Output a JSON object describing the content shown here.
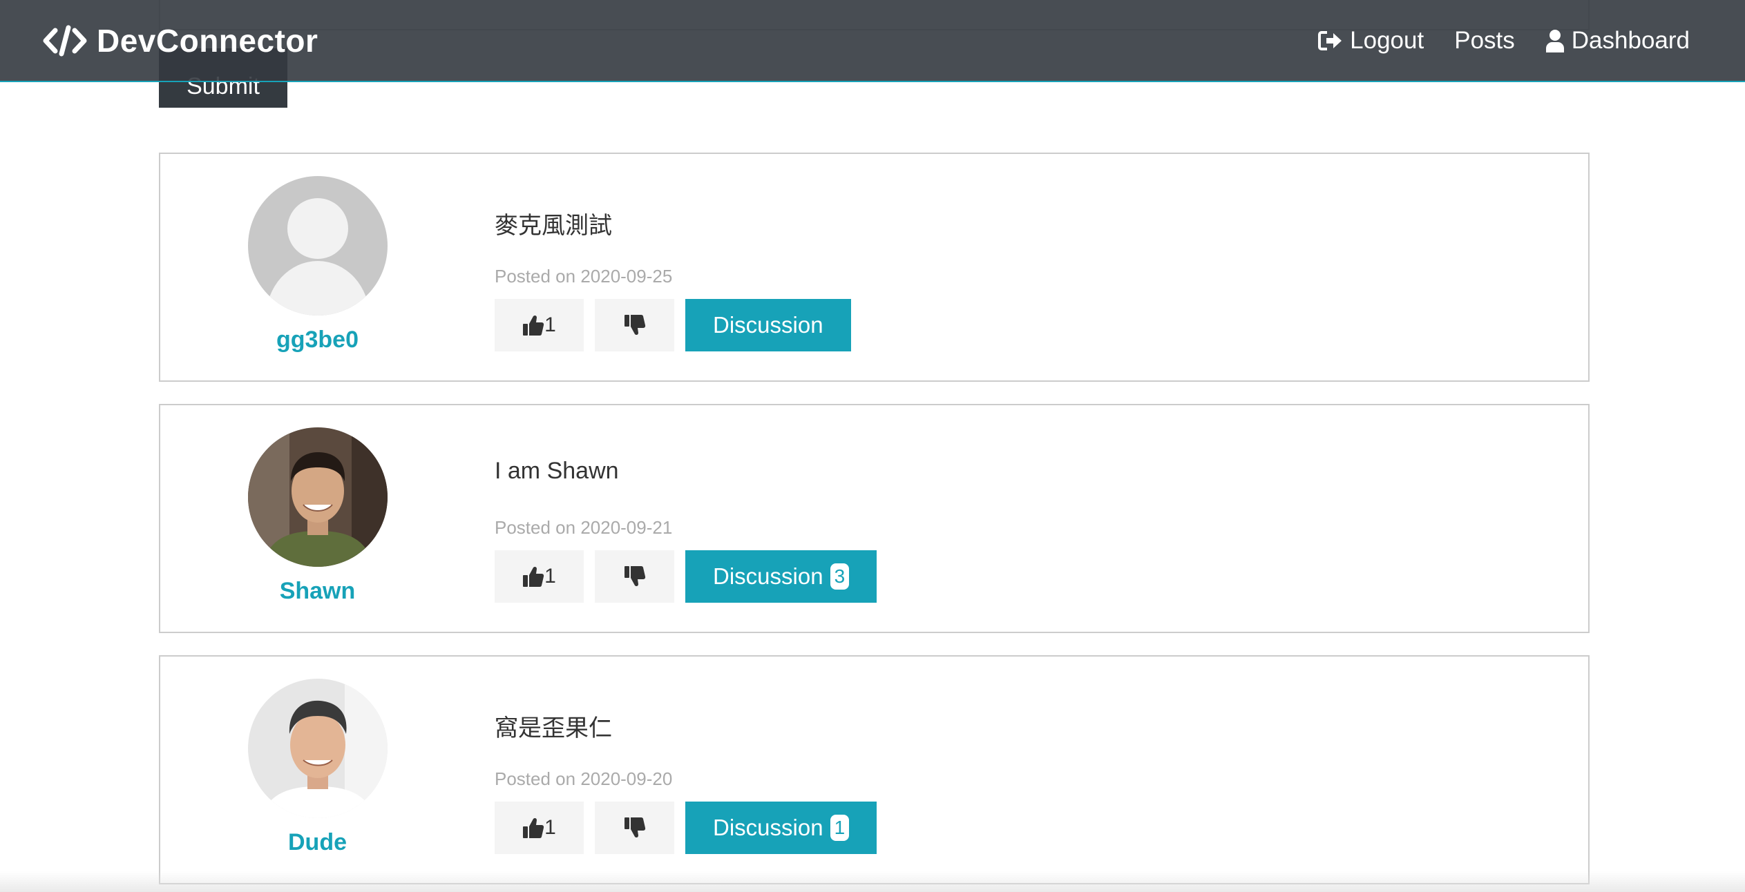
{
  "form": {
    "submit_label": "Submit"
  },
  "navbar": {
    "brand": "DevConnector",
    "links": [
      {
        "label": "Logout",
        "icon": "logout-icon"
      },
      {
        "label": "Posts"
      },
      {
        "label": "Dashboard",
        "icon": "user-icon"
      }
    ]
  },
  "posts": [
    {
      "author": "gg3be0",
      "avatar": "default-avatar",
      "text": "麥克風測試",
      "date": "Posted on 2020-09-25",
      "likes": "1",
      "discussion_label": "Discussion",
      "comments": ""
    },
    {
      "author": "Shawn",
      "avatar": "photo-avatar",
      "text": "I am Shawn",
      "date": "Posted on 2020-09-21",
      "likes": "1",
      "discussion_label": "Discussion",
      "comments": "3"
    },
    {
      "author": "Dude",
      "avatar": "photo-avatar",
      "text": "窩是歪果仁",
      "date": "Posted on 2020-09-20",
      "likes": "1",
      "discussion_label": "Discussion",
      "comments": "1"
    }
  ],
  "colors": {
    "primary": "#17a2b8",
    "dark": "#343a40",
    "light": "#f4f4f4"
  }
}
